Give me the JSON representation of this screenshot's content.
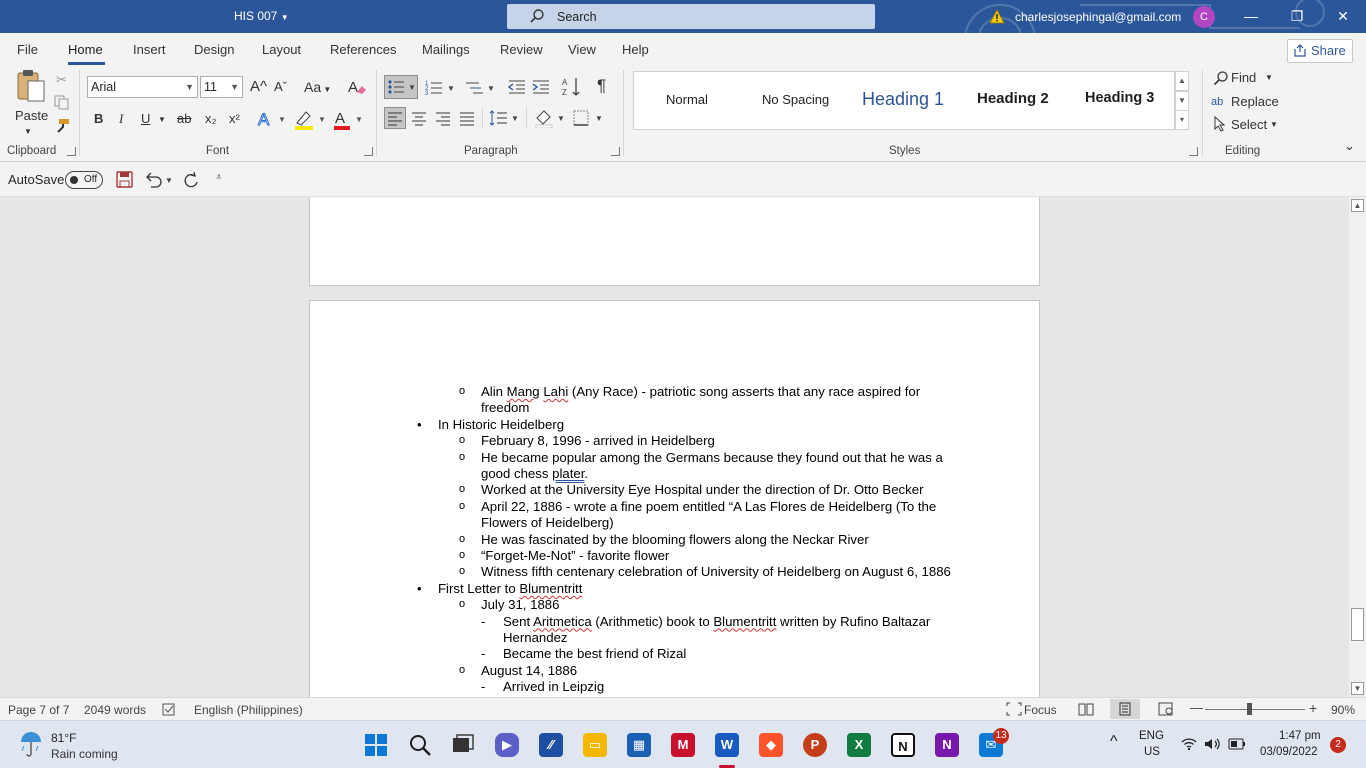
{
  "titlebar": {
    "doc_title": "HIS 007",
    "search_label": "Search",
    "account_email": "charlesjosephingal@gmail.com",
    "avatar_initial": "C",
    "minimize": "—",
    "restore": "❐",
    "close": "✕"
  },
  "ribbon_tabs": [
    "File",
    "Home",
    "Insert",
    "Design",
    "Layout",
    "References",
    "Mailings",
    "Review",
    "View",
    "Help"
  ],
  "share_label": "Share",
  "clipboard": {
    "paste_label": "Paste",
    "group_label": "Clipboard"
  },
  "font": {
    "name": "Arial",
    "size": "11",
    "group_label": "Font",
    "bold": "B",
    "italic": "I",
    "underline": "U",
    "strike": "ab",
    "subscript": "x₂",
    "superscript": "x²",
    "grow": "A^",
    "shrink": "Aˇ",
    "change_case": "Aa"
  },
  "paragraph": {
    "group_label": "Paragraph",
    "pilcrow": "¶"
  },
  "styles": {
    "group_label": "Styles",
    "items": [
      "Normal",
      "No Spacing",
      "Heading 1",
      "Heading 2",
      "Heading 3"
    ]
  },
  "editing": {
    "group_label": "Editing",
    "find": "Find",
    "replace": "Replace",
    "select": "Select"
  },
  "qat": {
    "autosave_label": "AutoSave",
    "autosave_state": "Off"
  },
  "document": {
    "lines": [
      {
        "level": 2,
        "marker": "o",
        "text_parts": [
          {
            "t": "Alin "
          },
          {
            "t": "Mang",
            "sq": true
          },
          {
            "t": " "
          },
          {
            "t": "Lahi",
            "sq": true
          },
          {
            "t": " (Any Race) - patriotic song asserts that any race aspired for"
          }
        ]
      },
      {
        "level": 2,
        "marker": "",
        "text_parts": [
          {
            "t": "freedom"
          }
        ]
      },
      {
        "level": 1,
        "marker": "•",
        "text_parts": [
          {
            "t": "In Historic Heidelberg"
          }
        ]
      },
      {
        "level": 2,
        "marker": "o",
        "text_parts": [
          {
            "t": "February 8, 1996 - arrived in Heidelberg"
          }
        ]
      },
      {
        "level": 2,
        "marker": "o",
        "text_parts": [
          {
            "t": "He became popular among the Germans because they found out that he was a"
          }
        ]
      },
      {
        "level": 2,
        "marker": "",
        "text_parts": [
          {
            "t": "good chess "
          },
          {
            "t": "plater",
            "dbl": true
          },
          {
            "t": "."
          }
        ]
      },
      {
        "level": 2,
        "marker": "o",
        "text_parts": [
          {
            "t": "Worked at the University Eye Hospital under the direction of Dr. Otto Becker"
          }
        ]
      },
      {
        "level": 2,
        "marker": "o",
        "text_parts": [
          {
            "t": "April 22, 1886 - wrote a fine poem entitled “A Las Flores de Heidelberg (To the"
          }
        ]
      },
      {
        "level": 2,
        "marker": "",
        "text_parts": [
          {
            "t": "Flowers of Heidelberg)"
          }
        ]
      },
      {
        "level": 2,
        "marker": "o",
        "text_parts": [
          {
            "t": "He was fascinated by the blooming flowers along the Neckar River"
          }
        ]
      },
      {
        "level": 2,
        "marker": "o",
        "text_parts": [
          {
            "t": "“Forget-Me-Not” - favorite flower"
          }
        ]
      },
      {
        "level": 2,
        "marker": "o",
        "text_parts": [
          {
            "t": "Witness fifth centenary celebration of University of Heidelberg on August 6, 1886"
          }
        ]
      },
      {
        "level": 1,
        "marker": "•",
        "text_parts": [
          {
            "t": "First Letter to "
          },
          {
            "t": "Blumentritt",
            "sq": true
          }
        ]
      },
      {
        "level": 2,
        "marker": "o",
        "text_parts": [
          {
            "t": "July 31, 1886"
          }
        ]
      },
      {
        "level": 3,
        "marker": "-",
        "text_parts": [
          {
            "t": "Sent "
          },
          {
            "t": "Aritmetica",
            "sq": true
          },
          {
            "t": " (Arithmetic) book to "
          },
          {
            "t": "Blumentritt",
            "sq": true
          },
          {
            "t": " written by Rufino Baltazar"
          }
        ]
      },
      {
        "level": 3,
        "marker": "",
        "text_parts": [
          {
            "t": "Hernandez"
          }
        ]
      },
      {
        "level": 3,
        "marker": "-",
        "text_parts": [
          {
            "t": "Became the best friend of Rizal"
          }
        ]
      },
      {
        "level": 2,
        "marker": "o",
        "text_parts": [
          {
            "t": "August 14, 1886"
          }
        ]
      },
      {
        "level": 3,
        "marker": "-",
        "text_parts": [
          {
            "t": "Arrived in Leipzig"
          }
        ]
      }
    ]
  },
  "statusbar": {
    "page": "Page 7 of 7",
    "words": "2049 words",
    "language": "English (Philippines)",
    "focus": "Focus",
    "zoom": "90%",
    "zoom_minus": "—",
    "zoom_plus": "+"
  },
  "taskbar": {
    "temperature": "81°F",
    "weather_desc": "Rain coming",
    "teams_badge": "13",
    "lang_1": "ENG",
    "lang_2": "US",
    "time": "1:47 pm",
    "date": "03/09/2022",
    "notif_badge": "2"
  },
  "colors": {
    "word_blue": "#2b579a",
    "ribbon_bg": "#f3f3f3",
    "doc_bg": "#e6e6e6"
  }
}
